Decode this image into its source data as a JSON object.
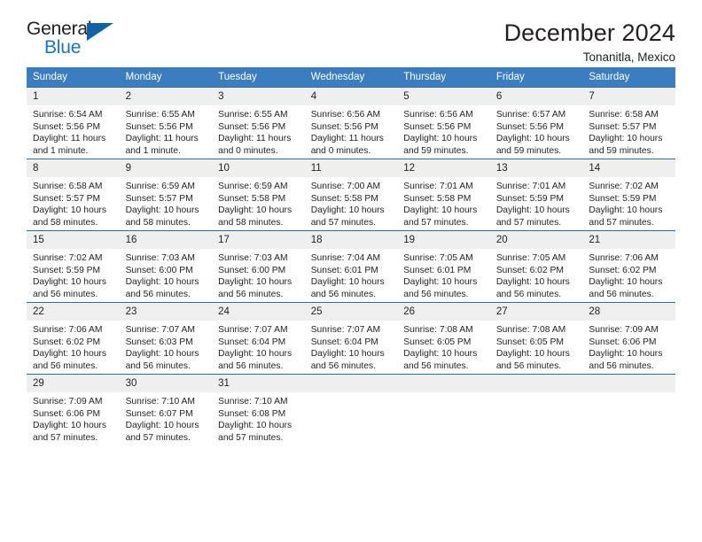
{
  "brand": {
    "name_part1": "General",
    "name_part2": "Blue",
    "triangle_color": "#1360a4",
    "blue_color": "#1d76bd"
  },
  "header": {
    "title": "December 2024",
    "location": "Tonanitla, Mexico"
  },
  "theme": {
    "header_row_bg": "#3b7dc0",
    "daynum_bg": "#efefef",
    "row_border": "#2f6ca8",
    "text": "#231f20"
  },
  "weekday_headers": [
    "Sunday",
    "Monday",
    "Tuesday",
    "Wednesday",
    "Thursday",
    "Friday",
    "Saturday"
  ],
  "weeks": [
    [
      {
        "day": "1",
        "sunrise": "Sunrise: 6:54 AM",
        "sunset": "Sunset: 5:56 PM",
        "daylight": "Daylight: 11 hours and 1 minute."
      },
      {
        "day": "2",
        "sunrise": "Sunrise: 6:55 AM",
        "sunset": "Sunset: 5:56 PM",
        "daylight": "Daylight: 11 hours and 1 minute."
      },
      {
        "day": "3",
        "sunrise": "Sunrise: 6:55 AM",
        "sunset": "Sunset: 5:56 PM",
        "daylight": "Daylight: 11 hours and 0 minutes."
      },
      {
        "day": "4",
        "sunrise": "Sunrise: 6:56 AM",
        "sunset": "Sunset: 5:56 PM",
        "daylight": "Daylight: 11 hours and 0 minutes."
      },
      {
        "day": "5",
        "sunrise": "Sunrise: 6:56 AM",
        "sunset": "Sunset: 5:56 PM",
        "daylight": "Daylight: 10 hours and 59 minutes."
      },
      {
        "day": "6",
        "sunrise": "Sunrise: 6:57 AM",
        "sunset": "Sunset: 5:56 PM",
        "daylight": "Daylight: 10 hours and 59 minutes."
      },
      {
        "day": "7",
        "sunrise": "Sunrise: 6:58 AM",
        "sunset": "Sunset: 5:57 PM",
        "daylight": "Daylight: 10 hours and 59 minutes."
      }
    ],
    [
      {
        "day": "8",
        "sunrise": "Sunrise: 6:58 AM",
        "sunset": "Sunset: 5:57 PM",
        "daylight": "Daylight: 10 hours and 58 minutes."
      },
      {
        "day": "9",
        "sunrise": "Sunrise: 6:59 AM",
        "sunset": "Sunset: 5:57 PM",
        "daylight": "Daylight: 10 hours and 58 minutes."
      },
      {
        "day": "10",
        "sunrise": "Sunrise: 6:59 AM",
        "sunset": "Sunset: 5:58 PM",
        "daylight": "Daylight: 10 hours and 58 minutes."
      },
      {
        "day": "11",
        "sunrise": "Sunrise: 7:00 AM",
        "sunset": "Sunset: 5:58 PM",
        "daylight": "Daylight: 10 hours and 57 minutes."
      },
      {
        "day": "12",
        "sunrise": "Sunrise: 7:01 AM",
        "sunset": "Sunset: 5:58 PM",
        "daylight": "Daylight: 10 hours and 57 minutes."
      },
      {
        "day": "13",
        "sunrise": "Sunrise: 7:01 AM",
        "sunset": "Sunset: 5:59 PM",
        "daylight": "Daylight: 10 hours and 57 minutes."
      },
      {
        "day": "14",
        "sunrise": "Sunrise: 7:02 AM",
        "sunset": "Sunset: 5:59 PM",
        "daylight": "Daylight: 10 hours and 57 minutes."
      }
    ],
    [
      {
        "day": "15",
        "sunrise": "Sunrise: 7:02 AM",
        "sunset": "Sunset: 5:59 PM",
        "daylight": "Daylight: 10 hours and 56 minutes."
      },
      {
        "day": "16",
        "sunrise": "Sunrise: 7:03 AM",
        "sunset": "Sunset: 6:00 PM",
        "daylight": "Daylight: 10 hours and 56 minutes."
      },
      {
        "day": "17",
        "sunrise": "Sunrise: 7:03 AM",
        "sunset": "Sunset: 6:00 PM",
        "daylight": "Daylight: 10 hours and 56 minutes."
      },
      {
        "day": "18",
        "sunrise": "Sunrise: 7:04 AM",
        "sunset": "Sunset: 6:01 PM",
        "daylight": "Daylight: 10 hours and 56 minutes."
      },
      {
        "day": "19",
        "sunrise": "Sunrise: 7:05 AM",
        "sunset": "Sunset: 6:01 PM",
        "daylight": "Daylight: 10 hours and 56 minutes."
      },
      {
        "day": "20",
        "sunrise": "Sunrise: 7:05 AM",
        "sunset": "Sunset: 6:02 PM",
        "daylight": "Daylight: 10 hours and 56 minutes."
      },
      {
        "day": "21",
        "sunrise": "Sunrise: 7:06 AM",
        "sunset": "Sunset: 6:02 PM",
        "daylight": "Daylight: 10 hours and 56 minutes."
      }
    ],
    [
      {
        "day": "22",
        "sunrise": "Sunrise: 7:06 AM",
        "sunset": "Sunset: 6:02 PM",
        "daylight": "Daylight: 10 hours and 56 minutes."
      },
      {
        "day": "23",
        "sunrise": "Sunrise: 7:07 AM",
        "sunset": "Sunset: 6:03 PM",
        "daylight": "Daylight: 10 hours and 56 minutes."
      },
      {
        "day": "24",
        "sunrise": "Sunrise: 7:07 AM",
        "sunset": "Sunset: 6:04 PM",
        "daylight": "Daylight: 10 hours and 56 minutes."
      },
      {
        "day": "25",
        "sunrise": "Sunrise: 7:07 AM",
        "sunset": "Sunset: 6:04 PM",
        "daylight": "Daylight: 10 hours and 56 minutes."
      },
      {
        "day": "26",
        "sunrise": "Sunrise: 7:08 AM",
        "sunset": "Sunset: 6:05 PM",
        "daylight": "Daylight: 10 hours and 56 minutes."
      },
      {
        "day": "27",
        "sunrise": "Sunrise: 7:08 AM",
        "sunset": "Sunset: 6:05 PM",
        "daylight": "Daylight: 10 hours and 56 minutes."
      },
      {
        "day": "28",
        "sunrise": "Sunrise: 7:09 AM",
        "sunset": "Sunset: 6:06 PM",
        "daylight": "Daylight: 10 hours and 56 minutes."
      }
    ],
    [
      {
        "day": "29",
        "sunrise": "Sunrise: 7:09 AM",
        "sunset": "Sunset: 6:06 PM",
        "daylight": "Daylight: 10 hours and 57 minutes."
      },
      {
        "day": "30",
        "sunrise": "Sunrise: 7:10 AM",
        "sunset": "Sunset: 6:07 PM",
        "daylight": "Daylight: 10 hours and 57 minutes."
      },
      {
        "day": "31",
        "sunrise": "Sunrise: 7:10 AM",
        "sunset": "Sunset: 6:08 PM",
        "daylight": "Daylight: 10 hours and 57 minutes."
      },
      {
        "day": "",
        "sunrise": "",
        "sunset": "",
        "daylight": ""
      },
      {
        "day": "",
        "sunrise": "",
        "sunset": "",
        "daylight": ""
      },
      {
        "day": "",
        "sunrise": "",
        "sunset": "",
        "daylight": ""
      },
      {
        "day": "",
        "sunrise": "",
        "sunset": "",
        "daylight": ""
      }
    ]
  ]
}
